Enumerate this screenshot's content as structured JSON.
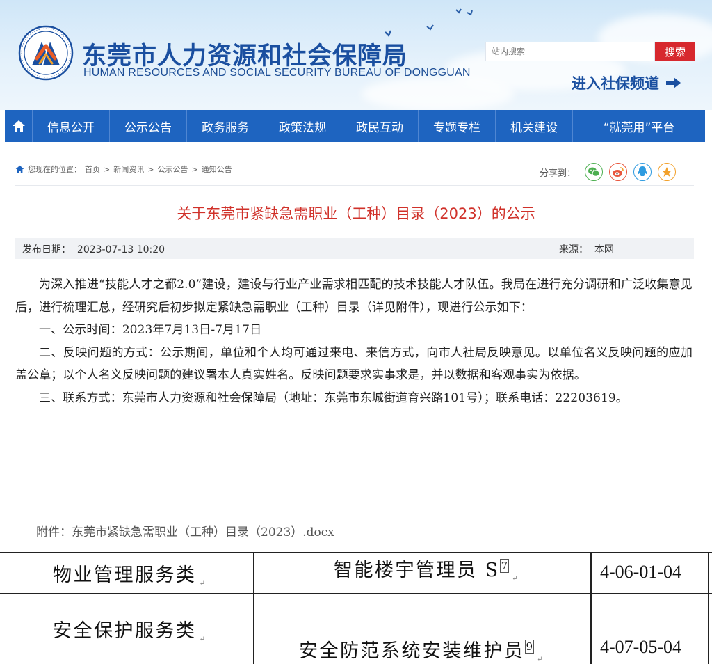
{
  "header": {
    "site_name_cn": "东莞市人力资源和社会保障局",
    "site_name_en": "HUMAN RESOURCES AND SOCIAL SECURITY BUREAU OF DONGGUAN",
    "search_placeholder": "站内搜索",
    "search_button": "搜索",
    "social_security_link": "进入社保频道"
  },
  "nav": {
    "items": [
      "信息公开",
      "公示公告",
      "政务服务",
      "政策法规",
      "政民互动",
      "专题专栏",
      "机关建设",
      "“就莞用”平台"
    ]
  },
  "breadcrumb": {
    "prefix": "您现在的位置：",
    "items": [
      "首页",
      "新闻资讯",
      "公示公告",
      "通知公告"
    ],
    "separator": ">"
  },
  "share": {
    "label": "分享到："
  },
  "article": {
    "title": "关于东莞市紧缺急需职业（工种）目录（2023）的公示",
    "date_label": "发布日期：",
    "date": "2023-07-13 10:20",
    "source_label": "来源：",
    "source": "本网",
    "paragraphs": [
      "为深入推进“技能人才之都2.0”建设，建设与行业产业需求相匹配的技术技能人才队伍。我局在进行充分调研和广泛收集意见后，进行梳理汇总，经研究后初步拟定紧缺急需职业（工种）目录（详见附件），现进行公示如下：",
      "一、公示时间：2023年7月13日-7月17日",
      "二、反映问题的方式：公示期间，单位和个人均可通过来电、来信方式，向市人社局反映意见。以单位名义反映问题的应加盖公章；以个人名义反映问题的建议署本人真实姓名。反映问题要求实事求是，并以数据和客观事实为依据。",
      "三、联系方式：东莞市人力资源和社会保障局（地址：东莞市东城街道育兴路101号）；联系电话：22203619。"
    ],
    "attachment_label": "附件：",
    "attachment_name": "东莞市紧缺急需职业（工种）目录（2023）.docx"
  },
  "table": {
    "rows": [
      {
        "category": "物业管理服务类",
        "occupation": "智能楼宇管理员 S",
        "note": "7",
        "code": "4-06-01-04"
      },
      {
        "category": "安全保护服务类",
        "occupation": "安全防范系统安装维护员",
        "note": "9",
        "code": "4-07-05-04"
      }
    ]
  },
  "colors": {
    "nav_blue": "#1e64c0",
    "brand_blue": "#1a4fa0",
    "title_red": "#d0312a",
    "search_red": "#d7282e"
  }
}
